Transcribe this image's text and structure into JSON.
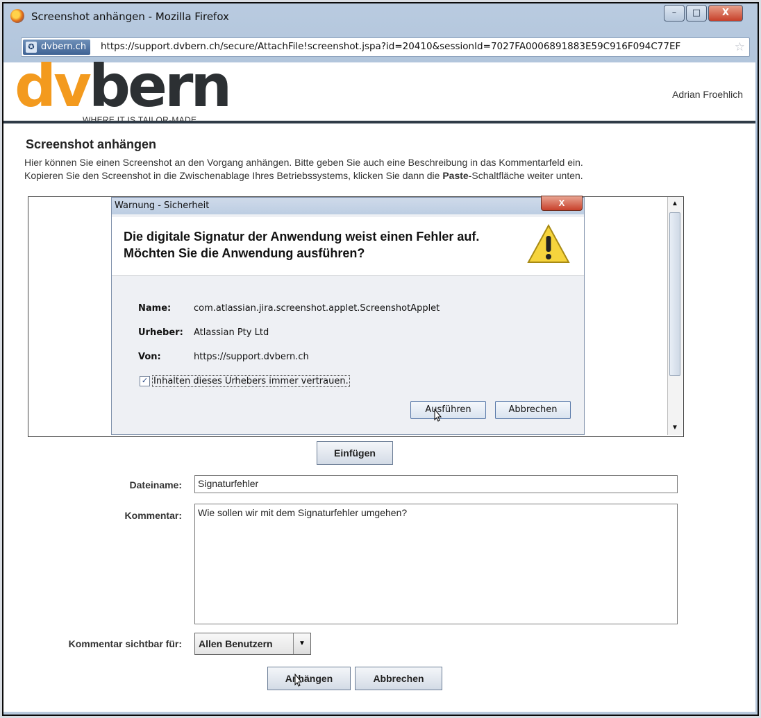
{
  "window": {
    "title": "Screenshot anhängen - Mozilla Firefox",
    "controls": {
      "minimize": "–",
      "maximize": "□",
      "close": "X"
    }
  },
  "urlbar": {
    "site_identity": "dvbern.ch",
    "url": "https://support.dvbern.ch/secure/AttachFile!screenshot.jspa?id=20410&sessionId=7027FA0006891883E59C916F094C77EF",
    "bookmark_icon": "star-icon"
  },
  "header": {
    "logo_text_orange": "dv",
    "logo_text_dark": "bern",
    "logo_tagline": "WHERE IT IS TAILOR-MADE",
    "user": "Adrian Froehlich",
    "colors": {
      "logo_orange": "#f39a1e",
      "header_rule": "#2f3b47"
    }
  },
  "page": {
    "title": "Screenshot anhängen",
    "intro_line1": "Hier können Sie einen Screenshot an den Vorgang anhängen. Bitte geben Sie auch eine Beschreibung in das Kommentarfeld ein.",
    "intro_line2_pre": "Kopieren Sie den Screenshot in die Zwischenablage Ihres Betriebssystems, klicken Sie dann die ",
    "intro_line2_bold": "Paste",
    "intro_line2_post": "-Schaltfläche weiter unten."
  },
  "security_dialog": {
    "title": "Warnung - Sicherheit",
    "heading": "Die digitale Signatur der Anwendung weist einen Fehler auf.  Möchten Sie die Anwendung ausführen?",
    "fields": [
      {
        "label": "Name:",
        "value": "com.atlassian.jira.screenshot.applet.ScreenshotApplet"
      },
      {
        "label": "Urheber:",
        "value": "Atlassian Pty Ltd"
      },
      {
        "label": "Von:",
        "value": "https://support.dvbern.ch"
      }
    ],
    "trust_checkbox": {
      "label": "Inhalten dieses Urhebers immer vertrauen.",
      "checked": true
    },
    "run_button": "Ausführen",
    "cancel_button": "Abbrechen"
  },
  "form": {
    "paste_button": "Einfügen",
    "filename_label": "Dateiname:",
    "filename_value": "Signaturfehler",
    "comment_label": "Kommentar:",
    "comment_value": "Wie sollen wir mit dem Signaturfehler umgehen?",
    "visibility_label": "Kommentar sichtbar für:",
    "visibility_value": "Allen Benutzern",
    "attach_button": "Anhängen",
    "cancel_button": "Abbrechen"
  }
}
